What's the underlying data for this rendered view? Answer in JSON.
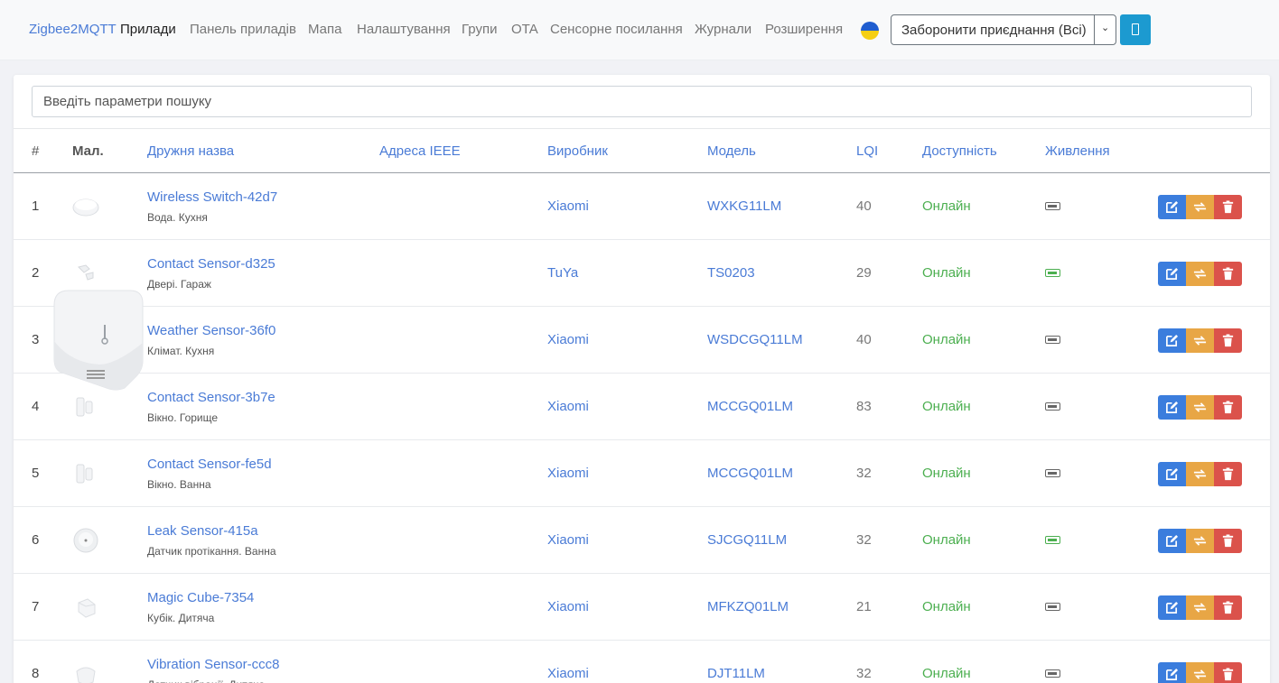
{
  "nav": {
    "brand": "Zigbee2MQTT",
    "items": [
      "Прилади",
      "Панель приладів",
      "Мапа",
      "Налаштування",
      "Групи",
      "OTA",
      "Сенсорне посилання",
      "Журнали",
      "Розширення"
    ],
    "active": "Прилади",
    "permit_join_label": "Заборонити приєднання (Всі)"
  },
  "search": {
    "placeholder": "Введіть параметри пошуку",
    "value": ""
  },
  "table": {
    "headers": {
      "num": "#",
      "pic": "Мал.",
      "name": "Дружня назва",
      "ieee": "Адреса IEEE",
      "vendor": "Виробник",
      "model": "Модель",
      "lqi": "LQI",
      "availability": "Доступність",
      "power": "Живлення"
    },
    "rows": [
      {
        "num": "1",
        "name": "Wireless Switch-42d7",
        "desc": "Вода. Кухня",
        "ieee": "",
        "vendor": "Xiaomi",
        "model": "WXKG11LM",
        "lqi": "40",
        "availability": "Онлайн",
        "power": "battery",
        "power_color": "#666666"
      },
      {
        "num": "2",
        "name": "Contact Sensor-d325",
        "desc": "Двері. Гараж",
        "ieee": "",
        "vendor": "TuYa",
        "model": "TS0203",
        "lqi": "29",
        "availability": "Онлайн",
        "power": "battery",
        "power_color": "#4caf50"
      },
      {
        "num": "3",
        "name": "Weather Sensor-36f0",
        "desc": "Клімат. Кухня",
        "ieee": "",
        "vendor": "Xiaomi",
        "model": "WSDCGQ11LM",
        "lqi": "40",
        "availability": "Онлайн",
        "power": "battery",
        "power_color": "#666666"
      },
      {
        "num": "4",
        "name": "Contact Sensor-3b7e",
        "desc": "Вікно. Горище",
        "ieee": "",
        "vendor": "Xiaomi",
        "model": "MCCGQ01LM",
        "lqi": "83",
        "availability": "Онлайн",
        "power": "battery",
        "power_color": "#666666"
      },
      {
        "num": "5",
        "name": "Contact Sensor-fe5d",
        "desc": "Вікно. Ванна",
        "ieee": "",
        "vendor": "Xiaomi",
        "model": "MCCGQ01LM",
        "lqi": "32",
        "availability": "Онлайн",
        "power": "battery",
        "power_color": "#666666"
      },
      {
        "num": "6",
        "name": "Leak Sensor-415a",
        "desc": "Датчик протікання. Ванна",
        "ieee": "",
        "vendor": "Xiaomi",
        "model": "SJCGQ11LM",
        "lqi": "32",
        "availability": "Онлайн",
        "power": "battery",
        "power_color": "#4caf50"
      },
      {
        "num": "7",
        "name": "Magic Cube-7354",
        "desc": "Кубік. Дитяча",
        "ieee": "",
        "vendor": "Xiaomi",
        "model": "MFKZQ01LM",
        "lqi": "21",
        "availability": "Онлайн",
        "power": "battery",
        "power_color": "#666666"
      },
      {
        "num": "8",
        "name": "Vibration Sensor-ccc8",
        "desc": "Датчик вібрації. Дитяча",
        "ieee": "",
        "vendor": "Xiaomi",
        "model": "DJT11LM",
        "lqi": "32",
        "availability": "Онлайн",
        "power": "battery",
        "power_color": "#666666"
      }
    ]
  },
  "colors": {
    "accent": "#4a7bd6",
    "online": "#4caf50",
    "edit": "#3b7ddd",
    "switch": "#e8a645",
    "delete": "#db524b",
    "permit_button": "#1c9ad0"
  },
  "icons": {
    "edit": "edit-icon",
    "switch": "switch-icon",
    "delete": "trash-icon",
    "power": "battery-icon"
  }
}
